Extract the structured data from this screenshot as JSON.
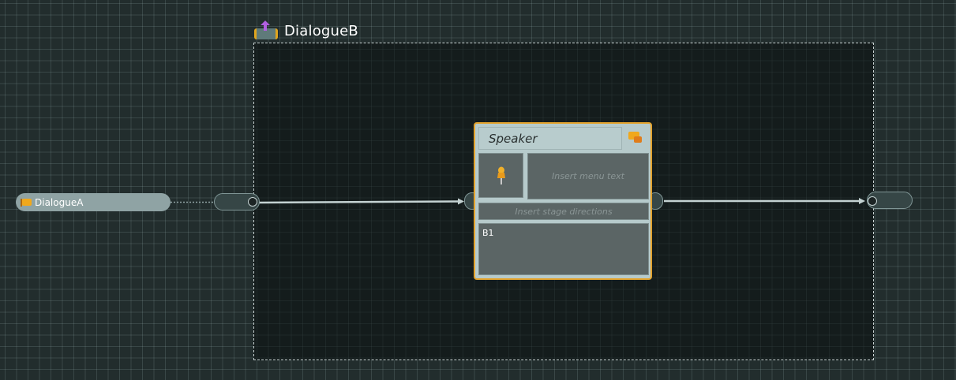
{
  "container": {
    "title": "DialogueB",
    "icon": "flow-container-icon"
  },
  "start_node": {
    "label": "DialogueA",
    "icon": "flag-icon"
  },
  "dialogue_card": {
    "speaker": "Speaker",
    "menu_text_placeholder": "Insert menu text",
    "stage_directions_placeholder": "Insert stage directions",
    "text": "B1",
    "speaker_icon": "chat-bubbles-icon",
    "portrait_icon": "pushpin-icon"
  },
  "colors": {
    "canvas_background": "#222d2d",
    "accent_orange": "#e3a32d",
    "card_background": "#b6cacb",
    "field_background": "#5b6565",
    "connection_line": "#c4d2d2",
    "container_arrow": "#b15fe0"
  }
}
